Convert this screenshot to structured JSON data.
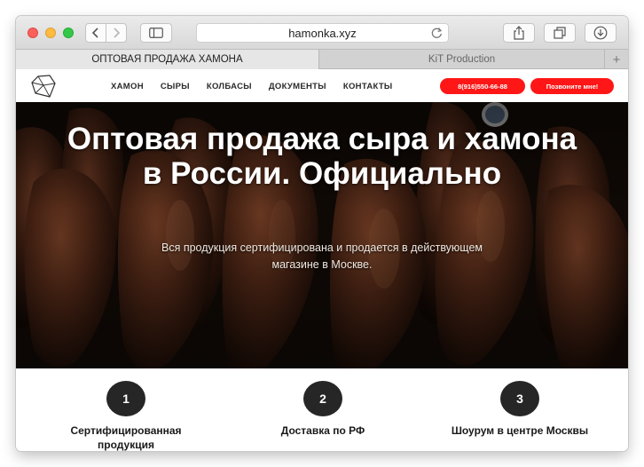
{
  "browser": {
    "url": "hamonka.xyz",
    "tabs": [
      {
        "label": "ОПТОВАЯ ПРОДАЖА ХАМОНА",
        "active": true
      },
      {
        "label": "KiT Production",
        "active": false
      }
    ],
    "new_tab_glyph": "+"
  },
  "site": {
    "menu": [
      "ХАМОН",
      "СЫРЫ",
      "КОЛБАСЫ",
      "ДОКУМЕНТЫ",
      "КОНТАКТЫ"
    ],
    "phone": "8(916)550-66-88",
    "call_button": "Позвоните мне!",
    "accent_color": "#ff1616"
  },
  "hero": {
    "title_line1": "Оптовая продажа сыра и хамона",
    "title_line2": "в России. Официально",
    "subtitle_line1": "Вся продукция сертифицирована и продается в действующем",
    "subtitle_line2": "магазине в Москве."
  },
  "features": [
    {
      "number": "1",
      "label_line1": "Сертифицированная",
      "label_line2": "продукция"
    },
    {
      "number": "2",
      "label_line1": "Доставка по РФ",
      "label_line2": ""
    },
    {
      "number": "3",
      "label_line1": "Шоурум в центре Москвы",
      "label_line2": ""
    }
  ]
}
